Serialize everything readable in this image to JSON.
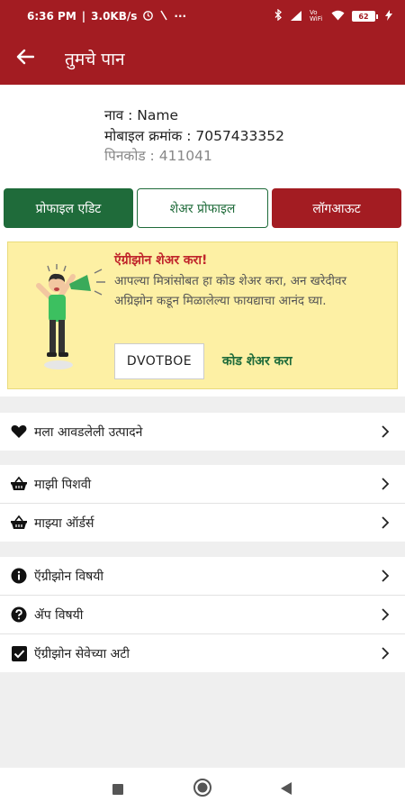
{
  "status_bar": {
    "time": "6:36 PM",
    "speed": "3.0KB/s",
    "overflow": "···",
    "network": "Vo WiFi",
    "battery": "62"
  },
  "app_bar": {
    "title": "तुमचे पान"
  },
  "profile": {
    "name_line": "नाव : Name",
    "mobile_line": "मोबाइल क्रमांक : 7057433352",
    "pincode_line": "पिनकोड : 411041"
  },
  "actions": {
    "edit_label": "प्रोफाइल एडिट",
    "share_label": "शेअर प्रोफाइल",
    "logout_label": "लॉगआऊट"
  },
  "referral": {
    "title": "ऍग्रीझोन शेअर करा!",
    "text": "आपल्या मित्रांसोबत हा कोड शेअर करा, अन खरेदीवर अग्रिझोन कडून मिळालेल्या फायद्याचा आनंद घ्या.",
    "code": "DVOTBOE",
    "share_code_label": "कोड शेअर करा"
  },
  "menu": {
    "favorites": "मला आवडलेली उत्पादने",
    "bag": "माझी पिशवी",
    "orders": "माझ्या ऑर्डर्स",
    "about_agrizone": "ऍग्रीझोन विषयी",
    "about_app": "ॲप विषयी",
    "terms": "ऍग्रीझोन सेवेच्या अटी"
  },
  "colors": {
    "primary": "#a31c22",
    "green": "#1f6b3a",
    "referral_bg": "#fdf0a4"
  },
  "icons": {
    "back": "arrow-left-icon",
    "favorites": "heart-icon",
    "bag": "basket-icon",
    "orders": "basket-icon",
    "about_agrizone": "info-icon",
    "about_app": "question-icon",
    "terms": "checkbox-icon"
  }
}
